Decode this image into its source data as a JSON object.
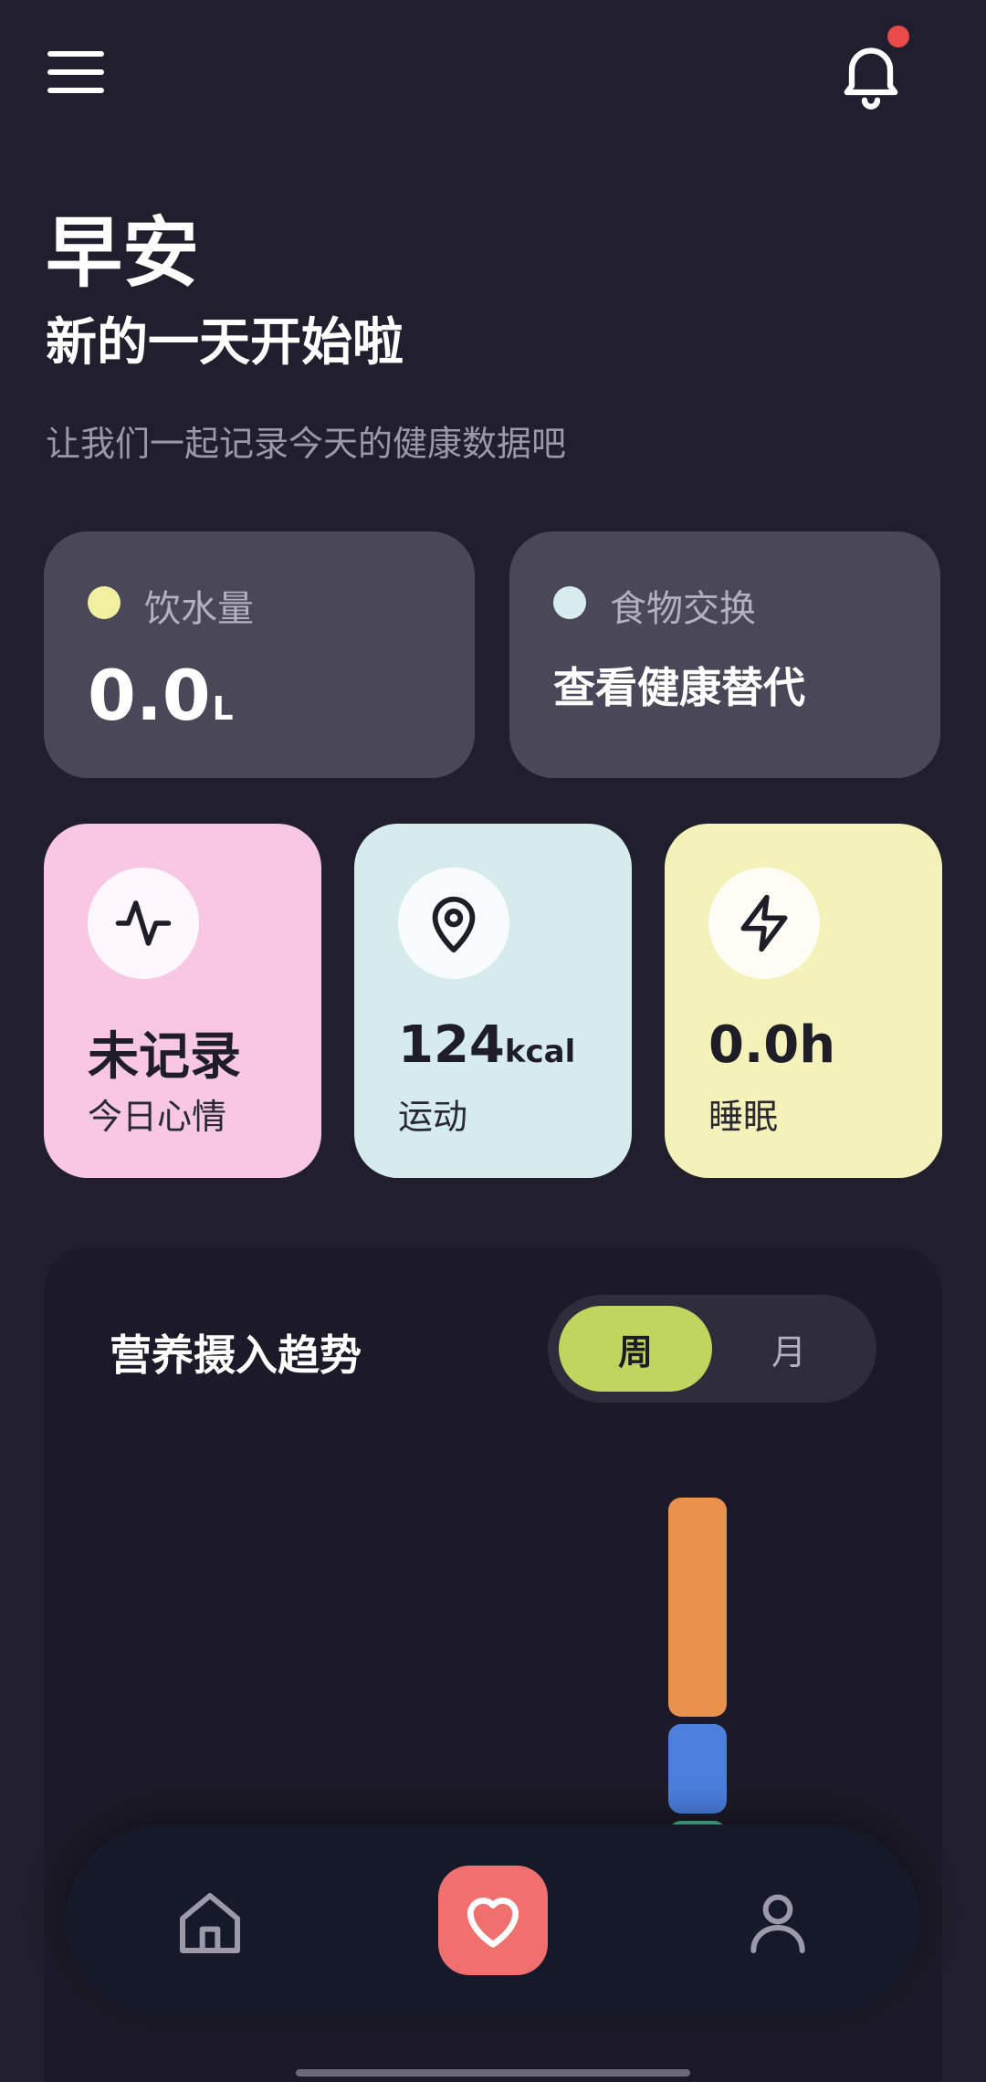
{
  "header": {
    "menu_icon": "hamburger-menu-icon",
    "bell_icon": "bell-icon",
    "has_notification": true
  },
  "greeting": {
    "title": "早安",
    "subtitle": "新的一天开始啦",
    "description": "让我们一起记录今天的健康数据吧"
  },
  "info_cards": {
    "water": {
      "label": "饮水量",
      "value": "0.0",
      "unit": "L",
      "dot_color": "#f3efa0"
    },
    "food": {
      "label": "食物交换",
      "value": "查看健康替代",
      "dot_color": "#d8ecef"
    }
  },
  "stat_cards": {
    "mood": {
      "value": "未记录",
      "label": "今日心情",
      "icon": "activity-pulse-icon",
      "color": "#f7c7e4"
    },
    "sport": {
      "value": "124",
      "unit": "kcal",
      "label": "运动",
      "icon": "map-pin-icon",
      "color": "#d6ebec"
    },
    "sleep": {
      "value": "0.0h",
      "label": "睡眠",
      "icon": "lightning-bolt-icon",
      "color": "#f4f2b8"
    }
  },
  "trend": {
    "title": "营养摄入趋势",
    "tabs": [
      {
        "label": "周",
        "selected": true
      },
      {
        "label": "月",
        "selected": false
      }
    ],
    "accent_color": "#bfd55e",
    "bar_colors": [
      "#e8924e",
      "#4c7fde",
      "#4ab896"
    ]
  },
  "bottom_nav": {
    "items": [
      {
        "icon": "home-icon",
        "active": false
      },
      {
        "icon": "heart-icon",
        "active": true
      },
      {
        "icon": "user-icon",
        "active": false
      }
    ]
  }
}
